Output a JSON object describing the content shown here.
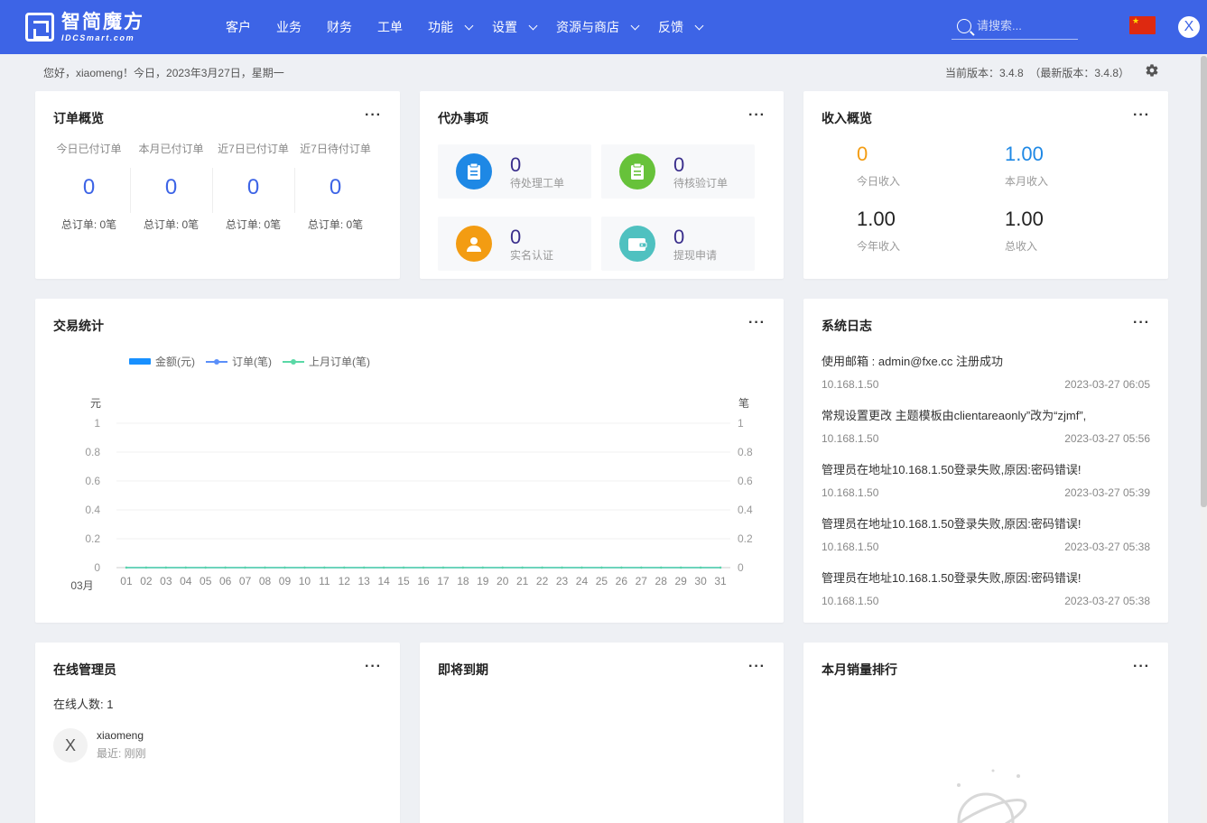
{
  "header": {
    "logo_cn": "智简魔方",
    "logo_en": "IDCSmart.com",
    "nav": [
      {
        "label": "客户",
        "dropdown": false
      },
      {
        "label": "业务",
        "dropdown": false
      },
      {
        "label": "财务",
        "dropdown": false
      },
      {
        "label": "工单",
        "dropdown": false
      },
      {
        "label": "功能",
        "dropdown": true
      },
      {
        "label": "设置",
        "dropdown": true
      },
      {
        "label": "资源与商店",
        "dropdown": true
      },
      {
        "label": "反馈",
        "dropdown": true
      }
    ],
    "search_placeholder": "请搜索...",
    "avatar_letter": "X",
    "accent": "#3d64e6"
  },
  "infobar": {
    "greeting": "您好，xiaomeng！今日，2023年3月27日，星期一",
    "version": "当前版本：3.4.8  （最新版本：3.4.8）"
  },
  "orders": {
    "title": "订单概览",
    "more": "···",
    "cols": [
      {
        "label": "今日已付订单",
        "value": "0",
        "total": "总订单: 0笔"
      },
      {
        "label": "本月已付订单",
        "value": "0",
        "total": "总订单: 0笔"
      },
      {
        "label": "近7日已付订单",
        "value": "0",
        "total": "总订单: 0笔"
      },
      {
        "label": "近7日待付订单",
        "value": "0",
        "total": "总订单: 0笔"
      }
    ]
  },
  "todo": {
    "title": "代办事项",
    "more": "···",
    "items": [
      {
        "value": "0",
        "label": "待处理工单",
        "color": "#1e88e5",
        "icon": "clipboard-icon"
      },
      {
        "value": "0",
        "label": "待核验订单",
        "color": "#67c23a",
        "icon": "clipboard-icon"
      },
      {
        "value": "0",
        "label": "实名认证",
        "color": "#f39c12",
        "icon": "user-icon"
      },
      {
        "value": "0",
        "label": "提现申请",
        "color": "#4fc1c0",
        "icon": "wallet-icon"
      }
    ]
  },
  "income": {
    "title": "收入概览",
    "more": "···",
    "items": [
      {
        "value": "0",
        "label": "今日收入",
        "color": "#f39c12"
      },
      {
        "value": "1.00",
        "label": "本月收入",
        "color": "#1e88e5"
      },
      {
        "value": "1.00",
        "label": "今年收入",
        "color": "#222222"
      },
      {
        "value": "1.00",
        "label": "总收入",
        "color": "#222222"
      }
    ]
  },
  "trade": {
    "title": "交易统计",
    "more": "···"
  },
  "chart_data": {
    "type": "line",
    "legend_position": "top-left",
    "series": [
      {
        "name": "金额(元)",
        "kind": "bar",
        "color": "#1890ff",
        "axis": "left",
        "values": [
          0,
          0,
          0,
          0,
          0,
          0,
          0,
          0,
          0,
          0,
          0,
          0,
          0,
          0,
          0,
          0,
          0,
          0,
          0,
          0,
          0,
          0,
          0,
          0,
          0,
          0,
          0,
          0,
          0,
          0,
          0
        ]
      },
      {
        "name": "订单(笔)",
        "kind": "line",
        "color": "#5b8ff9",
        "axis": "right",
        "values": [
          0,
          0,
          0,
          0,
          0,
          0,
          0,
          0,
          0,
          0,
          0,
          0,
          0,
          0,
          0,
          0,
          0,
          0,
          0,
          0,
          0,
          0,
          0,
          0,
          0,
          0,
          0,
          0,
          0,
          0,
          0
        ]
      },
      {
        "name": "上月订单(笔)",
        "kind": "line",
        "color": "#5ad8a6",
        "axis": "right",
        "values": [
          0,
          0,
          0,
          0,
          0,
          0,
          0,
          0,
          0,
          0,
          0,
          0,
          0,
          0,
          0,
          0,
          0,
          0,
          0,
          0,
          0,
          0,
          0,
          0,
          0,
          0,
          0,
          0,
          0,
          0,
          0
        ]
      }
    ],
    "categories": [
      "01",
      "02",
      "03",
      "04",
      "05",
      "06",
      "07",
      "08",
      "09",
      "10",
      "11",
      "12",
      "13",
      "14",
      "15",
      "16",
      "17",
      "18",
      "19",
      "20",
      "21",
      "22",
      "23",
      "24",
      "25",
      "26",
      "27",
      "28",
      "29",
      "30",
      "31"
    ],
    "x_prefix": "03月",
    "ylabel_left": "元",
    "ylabel_right": "笔",
    "ylim": [
      0,
      1
    ],
    "yticks": [
      "0",
      "0.2",
      "0.4",
      "0.6",
      "0.8",
      "1"
    ],
    "grid": true
  },
  "logs": {
    "title": "系统日志",
    "more": "···",
    "items": [
      {
        "text": "使用邮箱 : admin@fxe.cc 注册成功",
        "ip": "10.168.1.50",
        "time": "2023-03-27 06:05"
      },
      {
        "text": "常规设置更改 主题模板由clientareaonly”改为“zjmf”,",
        "ip": "10.168.1.50",
        "time": "2023-03-27 05:56"
      },
      {
        "text": "管理员在地址10.168.1.50登录失败,原因:密码错误!",
        "ip": "10.168.1.50",
        "time": "2023-03-27 05:39"
      },
      {
        "text": "管理员在地址10.168.1.50登录失败,原因:密码错误!",
        "ip": "10.168.1.50",
        "time": "2023-03-27 05:38"
      },
      {
        "text": "管理员在地址10.168.1.50登录失败,原因:密码错误!",
        "ip": "10.168.1.50",
        "time": "2023-03-27 05:38"
      }
    ]
  },
  "online": {
    "title": "在线管理员",
    "more": "···",
    "count": "在线人数: 1",
    "admin_avatar": "X",
    "admin_name": "xiaomeng",
    "admin_recent": "最近: 刚刚"
  },
  "expiring": {
    "title": "即将到期",
    "more": "···"
  },
  "ranking": {
    "title": "本月销量排行",
    "more": "···"
  }
}
